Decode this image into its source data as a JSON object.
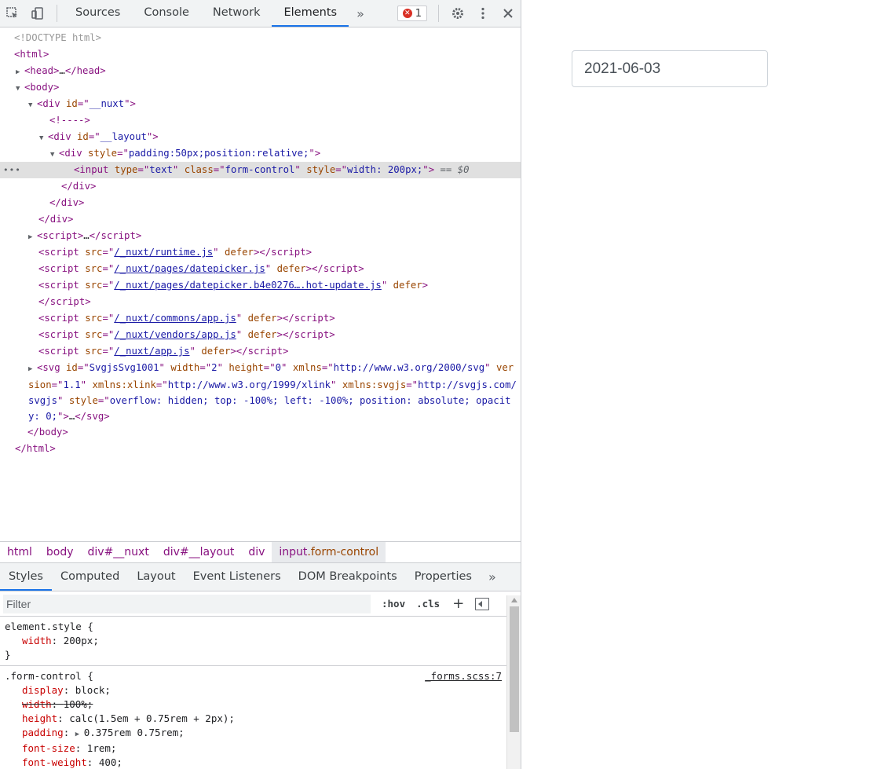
{
  "toolbar": {
    "tabs": [
      "Sources",
      "Console",
      "Network",
      "Elements"
    ],
    "more": "»",
    "error_count": "1"
  },
  "dom": {
    "doctype": "<!DOCTYPE html>",
    "html_open": "<html>",
    "head": "…",
    "nuxt_id": "__nuxt",
    "comment": "<!---->",
    "layout_id": "__layout",
    "div_style": "padding:50px;position:relative;",
    "input_type": "text",
    "input_class": "form-control",
    "input_style": "width: 200px;",
    "selected_marker": "== $0",
    "script_ellipsis": "…",
    "scripts": [
      {
        "src": "/_nuxt/runtime.js"
      },
      {
        "src": "/_nuxt/pages/datepicker.js"
      },
      {
        "src": "/_nuxt/pages/datepicker.b4e0276….hot-update.js"
      },
      {
        "src": "/_nuxt/commons/app.js"
      },
      {
        "src": "/_nuxt/vendors/app.js"
      },
      {
        "src": "/_nuxt/app.js"
      }
    ],
    "svg_id": "SvgjsSvg1001",
    "svg_width": "2",
    "svg_height": "0",
    "svg_xmlns": "http://www.w3.org/2000/svg",
    "svg_version": "1.1",
    "svg_xlink": "http://www.w3.org/1999/xlink",
    "svg_svgjs": "http://svgjs.com/svgjs",
    "svg_style": "overflow: hidden; top: -100%; left: -100%; position: absolute; opacity: 0;"
  },
  "breadcrumbs": [
    {
      "tag": "html"
    },
    {
      "tag": "body"
    },
    {
      "tag": "div",
      "id": "#__nuxt"
    },
    {
      "tag": "div",
      "id": "#__layout"
    },
    {
      "tag": "div"
    },
    {
      "tag": "input",
      "cls": ".form-control"
    }
  ],
  "subtabs": [
    "Styles",
    "Computed",
    "Layout",
    "Event Listeners",
    "DOM Breakpoints",
    "Properties"
  ],
  "filter": {
    "placeholder": "Filter",
    "hov": ":hov",
    "cls": ".cls",
    "plus": "+"
  },
  "styles": {
    "element_style": {
      "selector": "element.style {",
      "props": [
        {
          "name": "width",
          "value": "200px;"
        }
      ]
    },
    "form_control": {
      "selector": ".form-control {",
      "source": "_forms.scss:7",
      "props": [
        {
          "name": "display",
          "value": "block;"
        },
        {
          "name": "width",
          "value": "100%;",
          "overridden": true
        },
        {
          "name": "height",
          "value": "calc(1.5em + 0.75rem + 2px);"
        },
        {
          "name": "padding",
          "value": "0.375rem 0.75rem;"
        },
        {
          "name": "font-size",
          "value": "1rem;"
        },
        {
          "name": "font-weight",
          "value": "400;"
        }
      ]
    }
  },
  "page": {
    "date_value": "2021-06-03"
  }
}
